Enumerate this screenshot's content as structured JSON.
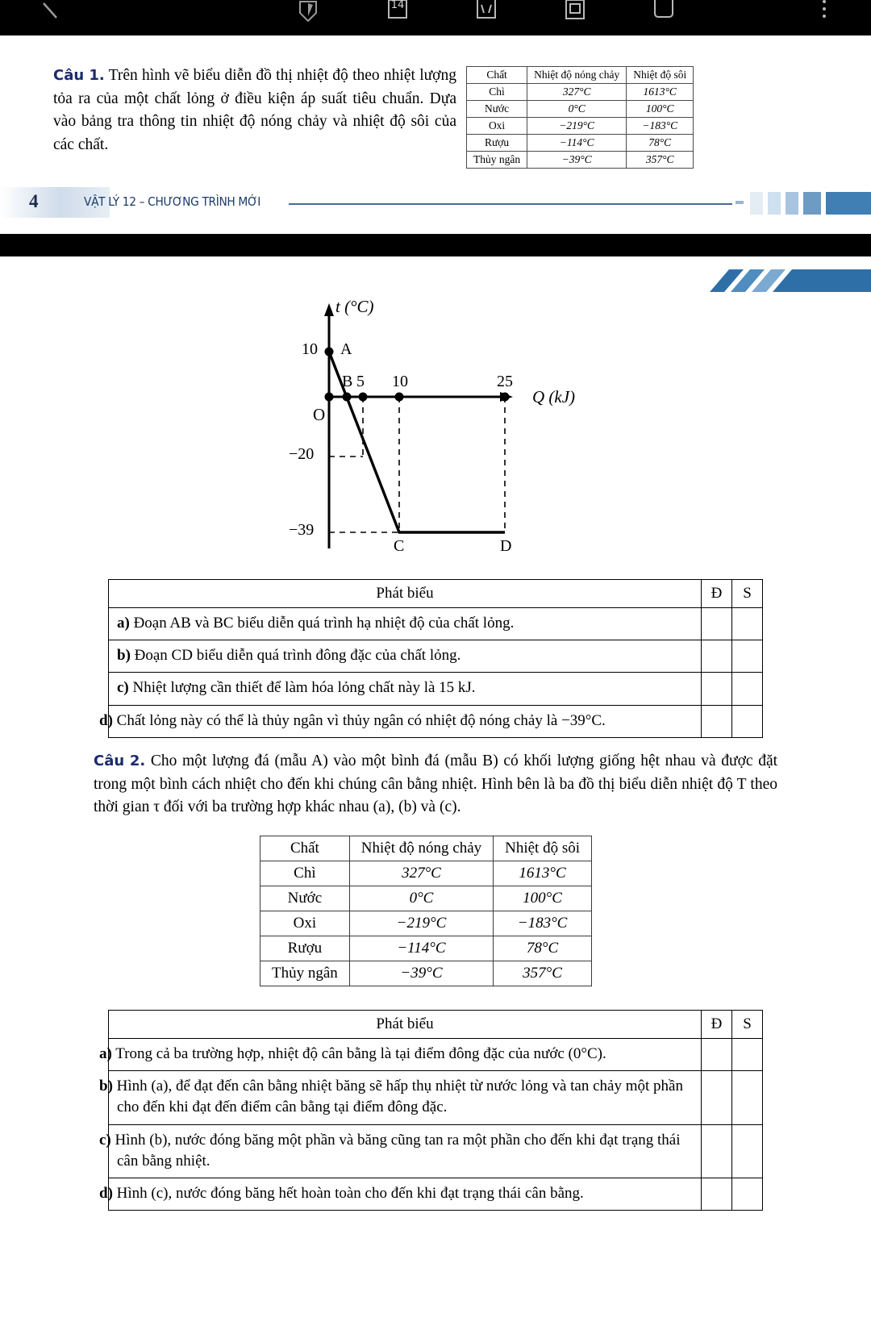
{
  "toolbar": {
    "icons": [
      {
        "name": "back-slash-icon",
        "glyph": "\\"
      },
      {
        "name": "bookmark-shield-icon",
        "glyph": "shield"
      },
      {
        "name": "page-14-icon",
        "glyph": "14"
      },
      {
        "name": "crop-icon",
        "glyph": "crop"
      },
      {
        "name": "duplicate-page-icon",
        "glyph": "duplicate"
      },
      {
        "name": "single-page-icon",
        "glyph": "page"
      },
      {
        "name": "more-options-icon",
        "glyph": "⋮"
      }
    ],
    "page_badge": "14"
  },
  "question1": {
    "label": "Câu",
    "number": "1.",
    "text": "Trên hình vẽ biểu diễn đồ thị nhiệt độ theo nhiệt lượng tỏa ra của một chất lỏng ở điều kiện áp suất tiêu chuẩn. Dựa vào bảng tra thông tin nhiệt độ nóng chảy và nhiệt độ sôi của các chất."
  },
  "substance_table": {
    "headers": [
      "Chất",
      "Nhiệt độ nóng chảy",
      "Nhiệt độ sôi"
    ],
    "rows": [
      [
        "Chì",
        "327°C",
        "1613°C"
      ],
      [
        "Nước",
        "0°C",
        "100°C"
      ],
      [
        "Oxi",
        "−219°C",
        "−183°C"
      ],
      [
        "Rượu",
        "−114°C",
        "78°C"
      ],
      [
        "Thủy ngân",
        "−39°C",
        "357°C"
      ]
    ]
  },
  "footer": {
    "page_number": "4",
    "title": "VẬT LÝ 12 – CHƯƠNG TRÌNH MỚI"
  },
  "chart_data": {
    "type": "line",
    "title": "",
    "xlabel": "Q (kJ)",
    "ylabel": "t (°C)",
    "xlim": [
      0,
      27
    ],
    "ylim": [
      -45,
      14
    ],
    "x_ticks": [
      5,
      10,
      25
    ],
    "x_tick_labels": [
      "5",
      "10",
      "25"
    ],
    "y_ticks": [
      10,
      -20,
      -39
    ],
    "y_tick_labels": [
      "10",
      "−20",
      "−39"
    ],
    "origin_label": "O",
    "points": [
      {
        "label": "A",
        "x": 0,
        "y": 10
      },
      {
        "label": "B",
        "x": 5,
        "y": -20
      },
      {
        "label": "C",
        "x": 10,
        "y": -39
      },
      {
        "label": "D",
        "x": 25,
        "y": -39
      }
    ],
    "series": [
      {
        "name": "cooling-curve",
        "x": [
          0,
          10,
          25
        ],
        "y": [
          10,
          -39,
          -39
        ]
      }
    ],
    "grid": false,
    "legend": "none"
  },
  "statements1": {
    "header_statement": "Phát biểu",
    "header_true": "Đ",
    "header_false": "S",
    "rows": [
      {
        "label": "a)",
        "text": "Đoạn AB và BC biểu diễn quá trình hạ nhiệt độ của chất lỏng."
      },
      {
        "label": "b)",
        "text": "Đoạn CD biểu diễn quá trình đông đặc của chất lỏng."
      },
      {
        "label": "c)",
        "text": "Nhiệt lượng cần thiết để làm hóa lỏng chất này là 15 kJ."
      },
      {
        "label": "d)",
        "text": "Chất lỏng này có thể là thủy ngân vì thủy ngân có nhiệt độ nóng chảy là −39°C."
      }
    ]
  },
  "question2": {
    "label": "Câu",
    "number": "2.",
    "text": "Cho một lượng đá (mẫu A) vào một bình đá (mẫu B) có khối lượng giống hệt nhau và được đặt trong một bình cách nhiệt cho đến khi chúng cân bằng nhiệt. Hình bên là ba đồ thị biểu diễn nhiệt độ T theo thời gian τ đối với ba trường hợp khác nhau (a), (b) và (c)."
  },
  "statements2": {
    "header_statement": "Phát biểu",
    "header_true": "Đ",
    "header_false": "S",
    "rows": [
      {
        "label": "a)",
        "text": "Trong cả ba trường hợp, nhiệt độ cân bằng là tại điểm đông đặc của nước (0°C)."
      },
      {
        "label": "b)",
        "text": "Hình (a), để đạt đến cân bằng nhiệt băng sẽ hấp thụ nhiệt từ nước lỏng và tan chảy một phần cho đến khi đạt đến điểm cân bằng tại điểm đông đặc."
      },
      {
        "label": "c)",
        "text": "Hình (b), nước đóng băng một phần và băng cũng tan ra một phần cho đến khi đạt trạng thái cân bằng nhiệt."
      },
      {
        "label": "d)",
        "text": "Hình (c), nước đóng băng hết hoàn toàn cho đến khi đạt trạng thái cân bằng."
      }
    ]
  },
  "colors": {
    "heading_blue": "#1b2b6b",
    "footer_blue": "#1b3b6b",
    "band_black": "#000000"
  }
}
